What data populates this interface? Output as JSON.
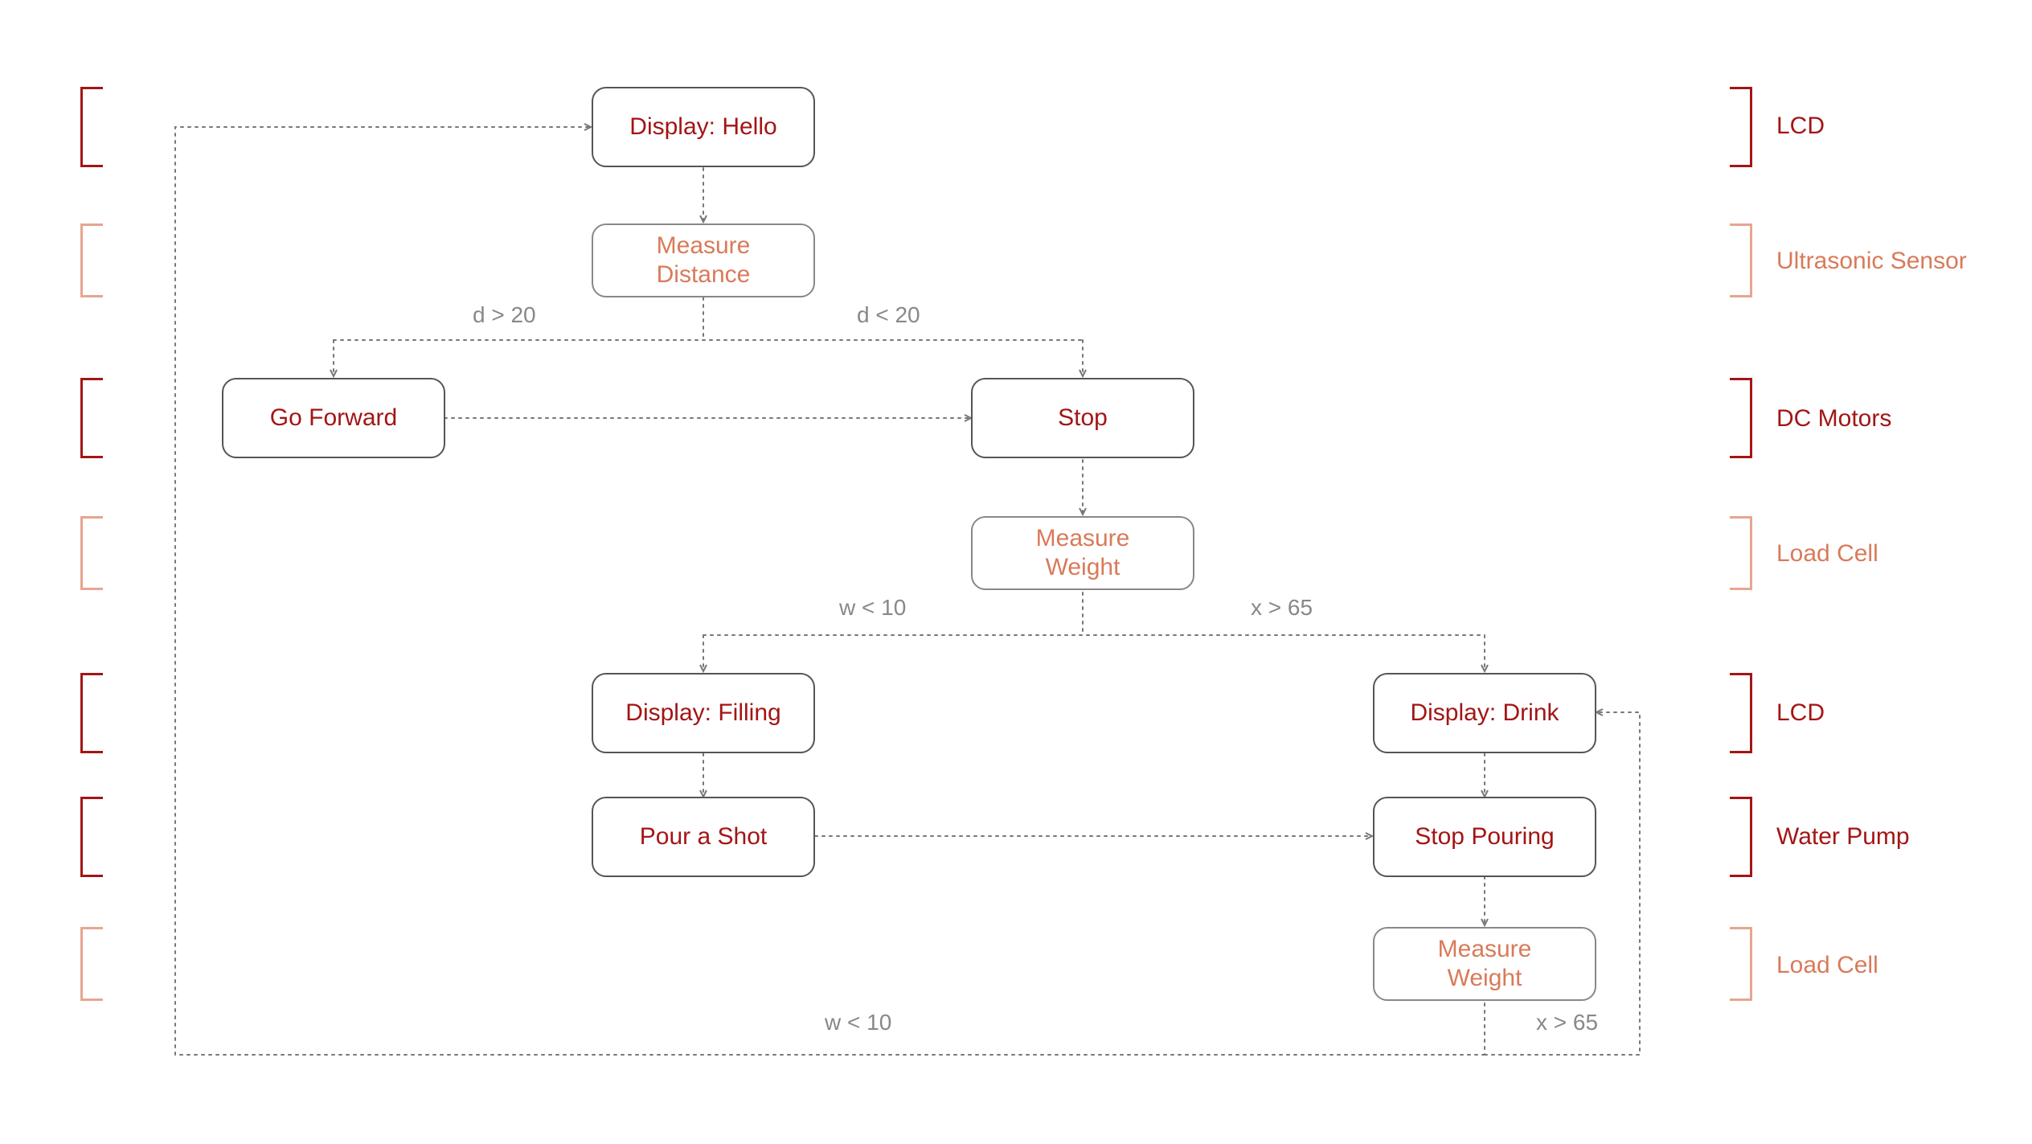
{
  "nodes": {
    "display_hello": "Display: Hello",
    "measure_distance": "Measure\nDistance",
    "go_forward": "Go Forward",
    "stop": "Stop",
    "measure_weight_1": "Measure\nWeight",
    "display_filling": "Display: Filling",
    "pour_a_shot": "Pour a Shot",
    "display_drink": "Display: Drink",
    "stop_pouring": "Stop Pouring",
    "measure_weight_2": "Measure\nWeight"
  },
  "edge_labels": {
    "d_gt_20": "d > 20",
    "d_lt_20": "d < 20",
    "w_lt_10_top": "w < 10",
    "x_gt_65_top": "x > 65",
    "w_lt_10_bottom": "w < 10",
    "x_gt_65_bottom": "x > 65"
  },
  "row_labels": {
    "lcd_1": "LCD",
    "ultrasonic": "Ultrasonic Sensor",
    "dc_motors": "DC Motors",
    "load_cell_1": "Load Cell",
    "lcd_2": "LCD",
    "water_pump": "Water Pump",
    "load_cell_2": "Load Cell"
  }
}
